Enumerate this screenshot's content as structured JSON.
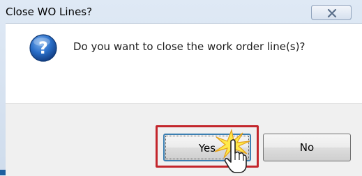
{
  "dialog": {
    "title": "Close WO Lines?",
    "message": "Do you want to close the work order line(s)?",
    "icon": "question-icon",
    "close_icon": "close-icon"
  },
  "buttons": {
    "yes_label": "Yes",
    "no_label": "No",
    "default": "Yes"
  },
  "annotation": {
    "highlight_color": "#c3262c",
    "highlighted_target": "Yes"
  },
  "colors": {
    "icon_blue": "#1d5fb8",
    "focus_border": "#3c7fb1"
  }
}
